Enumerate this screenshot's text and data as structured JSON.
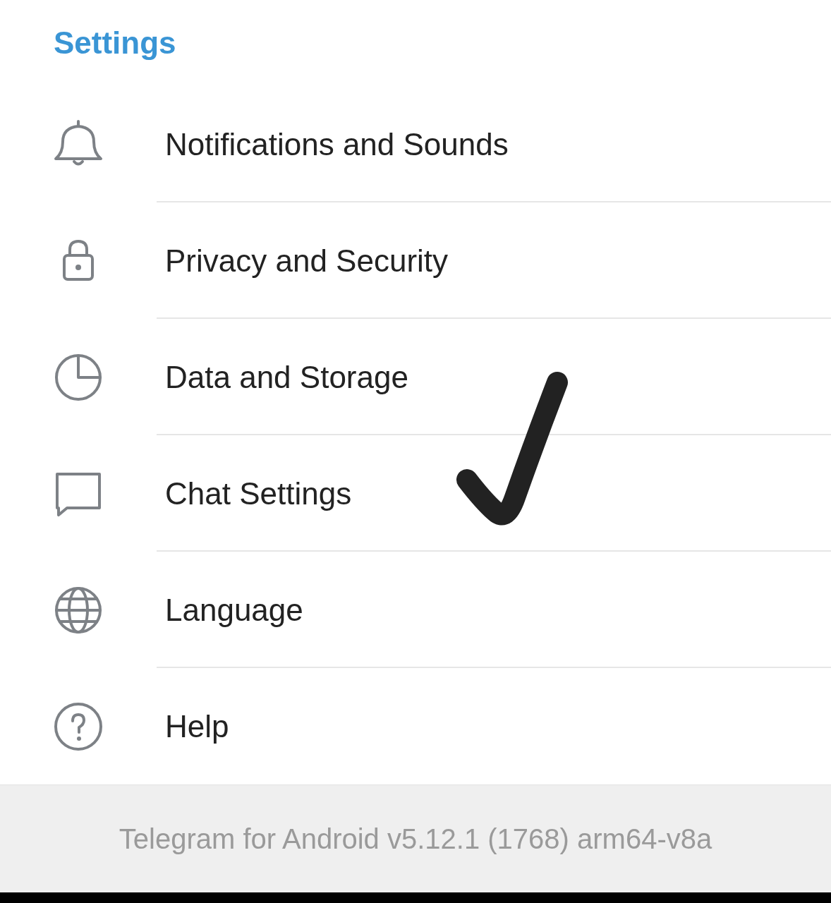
{
  "header": {
    "title": "Settings"
  },
  "items": [
    {
      "label": "Notifications and Sounds"
    },
    {
      "label": "Privacy and Security"
    },
    {
      "label": "Data and Storage"
    },
    {
      "label": "Chat Settings"
    },
    {
      "label": "Language"
    },
    {
      "label": "Help"
    }
  ],
  "annotation": {
    "kind": "checkmark"
  },
  "footer": {
    "version": "Telegram for Android v5.12.1 (1768) arm64-v8a"
  }
}
